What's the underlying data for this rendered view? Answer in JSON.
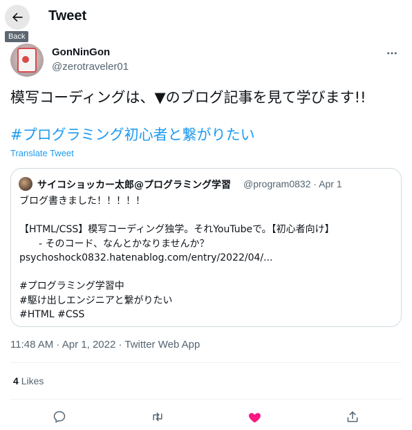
{
  "header": {
    "back_tooltip": "Back",
    "title": "Tweet"
  },
  "author": {
    "display_name": "GonNinGon",
    "handle": "@zerotraveler01"
  },
  "tweet": {
    "text": "模写コーディングは、▼のブログ記事を見て学びます!!",
    "hashtag": "#プログラミング初心者と繋がりたい",
    "translate_label": "Translate Tweet"
  },
  "quote": {
    "name": "サイコショッカー太郎@プログラミング学習",
    "meta": "@program0832 · Apr 1",
    "body": "ブログ書きました！！！！！\n\n【HTML/CSS】模写コーディング独学。それYouTubeで。【初心者向け】\n　　- そのコード、なんとかなりませんか？\npsychoshock0832.hatenablog.com/entry/2022/04/...\n\n#プログラミング学習中\n#駆け出しエンジニアと繋がりたい\n#HTML #CSS"
  },
  "timestamp": "11:48 AM · Apr 1, 2022 · Twitter Web App",
  "stats": {
    "likes_count": "4",
    "likes_label": "Likes"
  },
  "actions": {
    "reply_icon": "reply-icon",
    "retweet_icon": "retweet-icon",
    "like_icon": "heart-filled-icon",
    "share_icon": "share-icon"
  },
  "colors": {
    "accent": "#1d9bf0",
    "like": "#f91880",
    "muted": "#536471",
    "border": "#cfd9de"
  }
}
